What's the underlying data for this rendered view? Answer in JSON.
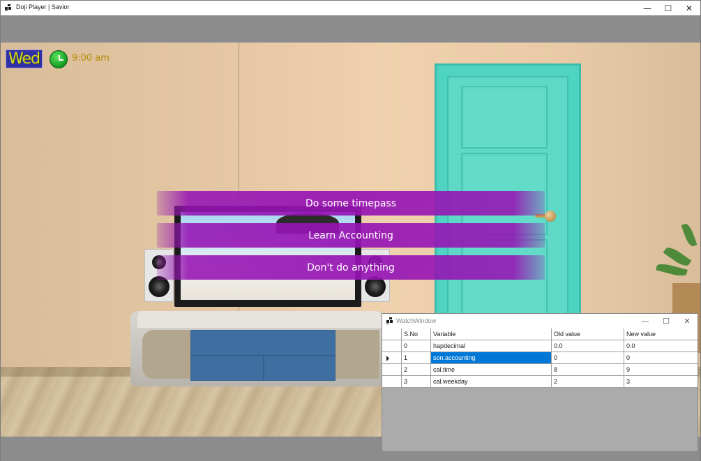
{
  "window": {
    "title": "Doji Player | Savior",
    "min_glyph": "—",
    "max_glyph": "☐",
    "close_glyph": "✕"
  },
  "hud": {
    "day": "Wed",
    "time": "9:00 am"
  },
  "choices": [
    {
      "label": "Do some timepass"
    },
    {
      "label": "Learn Accounting"
    },
    {
      "label": "Don't do anything"
    }
  ],
  "watch_window": {
    "title": "WatchWindow",
    "min_glyph": "—",
    "max_glyph": "☐",
    "close_glyph": "✕",
    "columns": [
      "S.No",
      "Variable",
      "Old value",
      "New value"
    ],
    "rows": [
      {
        "sno": "0",
        "variable": "hapdecimal",
        "old": "0.0",
        "new": "0.0"
      },
      {
        "sno": "1",
        "variable": "son.accounting",
        "old": "0",
        "new": "0"
      },
      {
        "sno": "2",
        "variable": "cal.time",
        "old": "8",
        "new": "9"
      },
      {
        "sno": "3",
        "variable": "cal.weekday",
        "old": "2",
        "new": "3"
      }
    ],
    "selected_row": 1
  },
  "colors": {
    "choice_bg": "#9614b4",
    "day_badge_bg": "#2f2fa8",
    "day_text": "#d7d82a",
    "time_text": "#b58c06",
    "selection": "#0078d7",
    "door": "#5ed8c7"
  },
  "icons": {
    "app": "app-window-icon",
    "clock": "clock-icon"
  }
}
